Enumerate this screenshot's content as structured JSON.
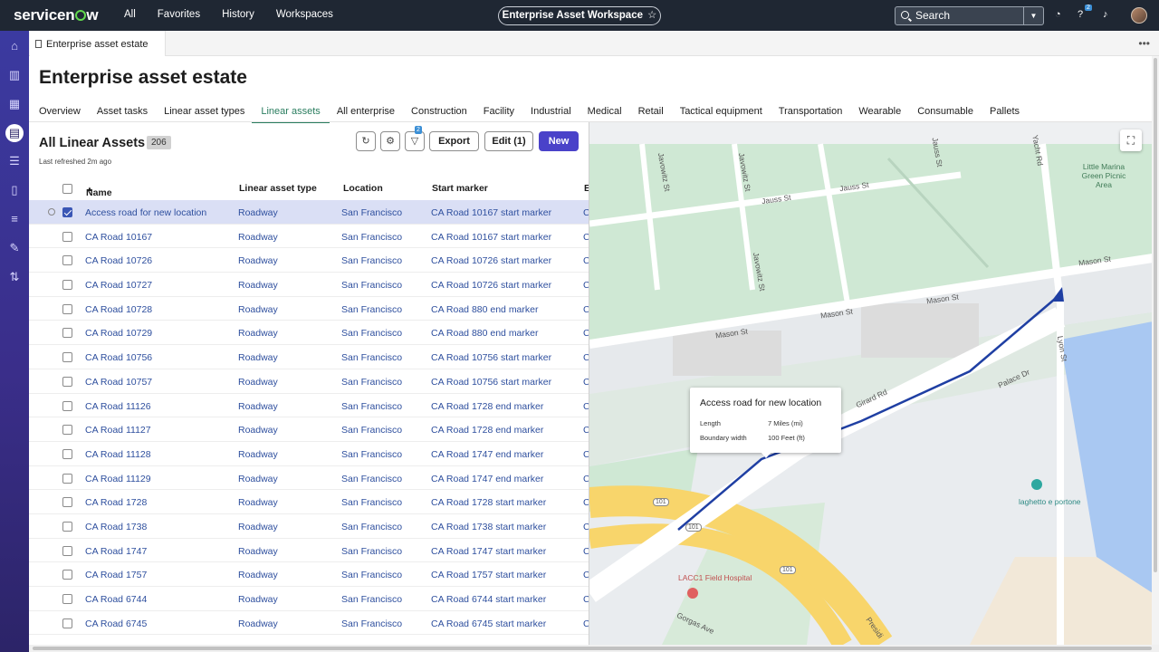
{
  "topnav": {
    "logo": "servicenow",
    "links": [
      "All",
      "Favorites",
      "History",
      "Workspaces"
    ],
    "workspace_pill": "Enterprise Asset Workspace",
    "search_label": "Search",
    "help_badge": "2"
  },
  "tab": {
    "label": "Enterprise asset estate"
  },
  "page": {
    "title": "Enterprise asset estate",
    "tabs": [
      "Overview",
      "Asset tasks",
      "Linear asset types",
      "Linear assets",
      "All enterprise",
      "Construction",
      "Facility",
      "Industrial",
      "Medical",
      "Retail",
      "Tactical equipment",
      "Transportation",
      "Wearable",
      "Consumable",
      "Pallets"
    ],
    "active_tab": "Linear assets"
  },
  "list": {
    "title": "All Linear Assets",
    "count": "206",
    "refreshed": "Last refreshed 2m ago",
    "filter_badge": "2",
    "export_label": "Export",
    "edit_label": "Edit (1)",
    "new_label": "New",
    "columns": {
      "name": "Name",
      "type": "Linear asset type",
      "location": "Location",
      "start": "Start marker",
      "end": "E"
    },
    "rows": [
      {
        "name": "Access road for new location",
        "type": "Roadway",
        "location": "San Francisco",
        "start": "CA Road 10167 start marker",
        "end": "C"
      },
      {
        "name": "CA Road 10167",
        "type": "Roadway",
        "location": "San Francisco",
        "start": "CA Road 10167 start marker",
        "end": "C"
      },
      {
        "name": "CA Road 10726",
        "type": "Roadway",
        "location": "San Francisco",
        "start": "CA Road 10726 start marker",
        "end": "C"
      },
      {
        "name": "CA Road 10727",
        "type": "Roadway",
        "location": "San Francisco",
        "start": "CA Road 10726 start marker",
        "end": "C"
      },
      {
        "name": "CA Road 10728",
        "type": "Roadway",
        "location": "San Francisco",
        "start": "CA Road 880 end marker",
        "end": "C"
      },
      {
        "name": "CA Road 10729",
        "type": "Roadway",
        "location": "San Francisco",
        "start": "CA Road 880 end marker",
        "end": "C"
      },
      {
        "name": "CA Road 10756",
        "type": "Roadway",
        "location": "San Francisco",
        "start": "CA Road 10756 start marker",
        "end": "C"
      },
      {
        "name": "CA Road 10757",
        "type": "Roadway",
        "location": "San Francisco",
        "start": "CA Road 10756 start marker",
        "end": "C"
      },
      {
        "name": "CA Road 11126",
        "type": "Roadway",
        "location": "San Francisco",
        "start": "CA Road 1728 end marker",
        "end": "C"
      },
      {
        "name": "CA Road 11127",
        "type": "Roadway",
        "location": "San Francisco",
        "start": "CA Road 1728 end marker",
        "end": "C"
      },
      {
        "name": "CA Road 11128",
        "type": "Roadway",
        "location": "San Francisco",
        "start": "CA Road 1747 end marker",
        "end": "C"
      },
      {
        "name": "CA Road 11129",
        "type": "Roadway",
        "location": "San Francisco",
        "start": "CA Road 1747 end marker",
        "end": "C"
      },
      {
        "name": "CA Road 1728",
        "type": "Roadway",
        "location": "San Francisco",
        "start": "CA Road 1728 start marker",
        "end": "C"
      },
      {
        "name": "CA Road 1738",
        "type": "Roadway",
        "location": "San Francisco",
        "start": "CA Road 1738 start marker",
        "end": "C"
      },
      {
        "name": "CA Road 1747",
        "type": "Roadway",
        "location": "San Francisco",
        "start": "CA Road 1747 start marker",
        "end": "C"
      },
      {
        "name": "CA Road 1757",
        "type": "Roadway",
        "location": "San Francisco",
        "start": "CA Road 1757 start marker",
        "end": "C"
      },
      {
        "name": "CA Road 6744",
        "type": "Roadway",
        "location": "San Francisco",
        "start": "CA Road 6744 start marker",
        "end": "C"
      },
      {
        "name": "CA Road 6745",
        "type": "Roadway",
        "location": "San Francisco",
        "start": "CA Road 6745 start marker",
        "end": "C"
      }
    ]
  },
  "map": {
    "popup": {
      "title": "Access road for new location",
      "length_label": "Length",
      "length_value": "7 Miles (mi)",
      "width_label": "Boundary width",
      "width_value": "100 Feet (ft)"
    },
    "labels": {
      "jauss1": "Jauss St",
      "jauss2": "Jauss St",
      "javowitz1": "Javowitz St",
      "javowitz2": "Javowitz St",
      "javowitz3": "Javowitz St",
      "mason1": "Mason St",
      "mason2": "Mason St",
      "mason3": "Mason St",
      "mason4": "Mason St",
      "yacht": "Yacht Rd",
      "lyon": "Lyon St",
      "palace": "Palace Dr",
      "girard": "Girard Rd",
      "park": "Little Marina Green Picnic Area",
      "laghetto": "laghetto e portone",
      "hospital": "LACC1 Field Hospital",
      "gorgas": "Gorgas Ave",
      "presidio": "Presidi",
      "hw1": "101",
      "hw2": "101",
      "hw3": "101"
    },
    "colors": {
      "route": "#1f3fa3",
      "green": "#cfe8d4",
      "water": "#a9c8f2",
      "highway": "#f8d56b"
    }
  }
}
